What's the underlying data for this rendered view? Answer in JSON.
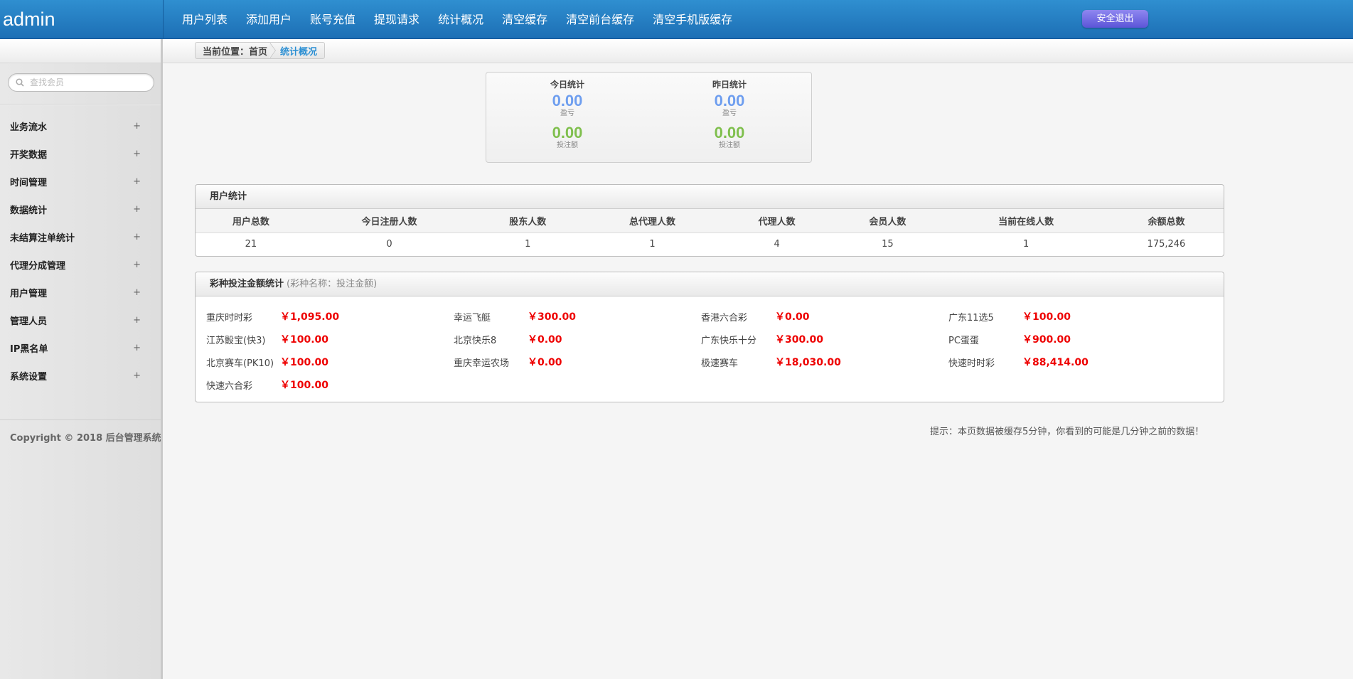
{
  "header": {
    "brand": "admin",
    "nav": [
      "用户列表",
      "添加用户",
      "账号充值",
      "提现请求",
      "统计概况",
      "清空缓存",
      "清空前台缓存",
      "清空手机版缓存"
    ],
    "logout_label": "安全退出"
  },
  "breadcrumb": {
    "prefix": "当前位置：首页",
    "current": "统计概况"
  },
  "sidebar": {
    "search_placeholder": "查找会员",
    "items": [
      {
        "label": "业务流水",
        "toggle": "+"
      },
      {
        "label": "开奖数据",
        "toggle": "+"
      },
      {
        "label": "时间管理",
        "toggle": "+"
      },
      {
        "label": "数据统计",
        "toggle": "+"
      },
      {
        "label": "未结算注单统计",
        "toggle": "+"
      },
      {
        "label": "代理分成管理",
        "toggle": "+"
      },
      {
        "label": "用户管理",
        "toggle": "+"
      },
      {
        "label": "管理人员",
        "toggle": "+"
      },
      {
        "label": "IP黑名单",
        "toggle": "+"
      },
      {
        "label": "系统设置",
        "toggle": "+"
      }
    ],
    "copyright": "Copyright © 2018 后台管理系统"
  },
  "stats": {
    "today": {
      "title": "今日统计",
      "profit": "0.00",
      "profit_label": "盈亏",
      "bet": "0.00",
      "bet_label": "投注额"
    },
    "yesterday": {
      "title": "昨日统计",
      "profit": "0.00",
      "profit_label": "盈亏",
      "bet": "0.00",
      "bet_label": "投注额"
    }
  },
  "user_stats": {
    "title": "用户统计",
    "columns": [
      "用户总数",
      "今日注册人数",
      "股东人数",
      "总代理人数",
      "代理人数",
      "会员人数",
      "当前在线人数",
      "余额总数"
    ],
    "values": [
      "21",
      "0",
      "1",
      "1",
      "4",
      "15",
      "1",
      "175,246"
    ]
  },
  "lottery_stats": {
    "title": "彩种投注金额统计",
    "subtitle": "(彩种名称：投注金额)",
    "items": [
      {
        "name": "重庆时时彩",
        "amount": "￥1,095.00"
      },
      {
        "name": "幸运飞艇",
        "amount": "￥300.00"
      },
      {
        "name": "香港六合彩",
        "amount": "￥0.00"
      },
      {
        "name": "广东11选5",
        "amount": "￥100.00"
      },
      {
        "name": "江苏骰宝(快3)",
        "amount": "￥100.00"
      },
      {
        "name": "北京快乐8",
        "amount": "￥0.00"
      },
      {
        "name": "广东快乐十分",
        "amount": "￥300.00"
      },
      {
        "name": "PC蛋蛋",
        "amount": "￥900.00"
      },
      {
        "name": "北京赛车(PK10)",
        "amount": "￥100.00"
      },
      {
        "name": "重庆幸运农场",
        "amount": "￥0.00"
      },
      {
        "name": "极速赛车",
        "amount": "￥18,030.00"
      },
      {
        "name": "快速时时彩",
        "amount": "￥88,414.00"
      },
      {
        "name": "快速六合彩",
        "amount": "￥100.00"
      }
    ]
  },
  "tip": "提示：本页数据被缓存5分钟，你看到的可能是几分钟之前的数据！",
  "colors": {
    "header": "#1d6fb5",
    "logout": "#6f68e2",
    "profit": "#6e9eef",
    "bet": "#7fbf4d",
    "amount": "#ee0000"
  }
}
